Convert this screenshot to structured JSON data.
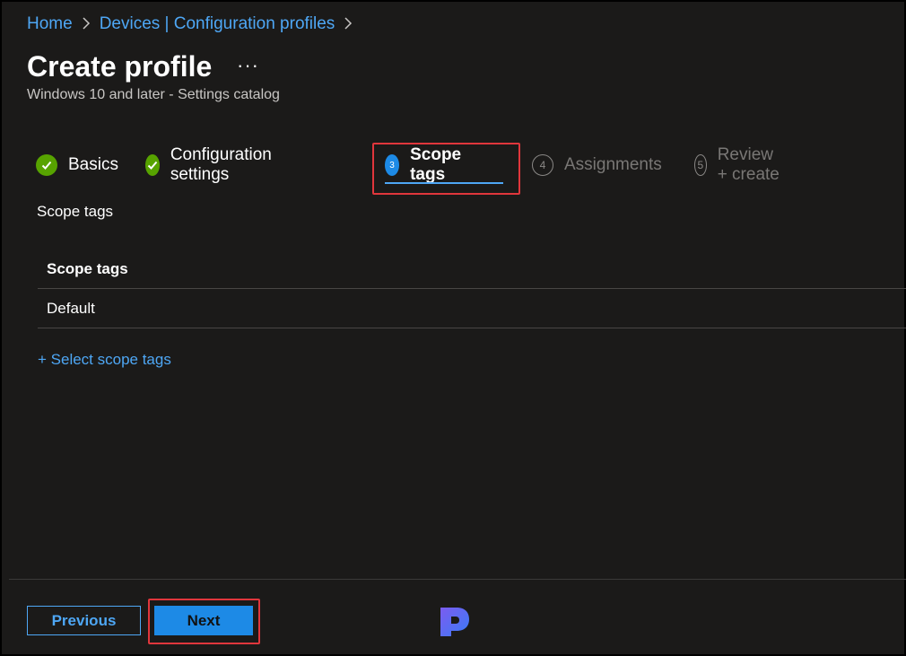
{
  "breadcrumb": {
    "items": [
      "Home",
      "Devices | Configuration profiles"
    ]
  },
  "header": {
    "title": "Create profile",
    "more_label": "···",
    "subtitle": "Windows 10 and later - Settings catalog"
  },
  "steps": [
    {
      "label": "Basics",
      "state": "done"
    },
    {
      "label": "Configuration settings",
      "state": "done"
    },
    {
      "label": "Scope tags",
      "state": "current",
      "number": "3"
    },
    {
      "label": "Assignments",
      "state": "future",
      "number": "4"
    },
    {
      "label": "Review + create",
      "state": "future",
      "number": "5"
    }
  ],
  "main": {
    "section_label": "Scope tags",
    "table": {
      "header": "Scope tags",
      "rows": [
        "Default"
      ]
    },
    "select_link": "+ Select scope tags"
  },
  "footer": {
    "previous_label": "Previous",
    "next_label": "Next"
  },
  "colors": {
    "background": "#1b1a19",
    "accent": "#4ea7f5",
    "primary_button": "#1d8ae6",
    "success": "#57a300",
    "highlight": "#e0363c"
  },
  "icons": {
    "check": "check-circle-icon",
    "chevron": "chevron-right-icon",
    "logo": "logo-p-icon"
  }
}
